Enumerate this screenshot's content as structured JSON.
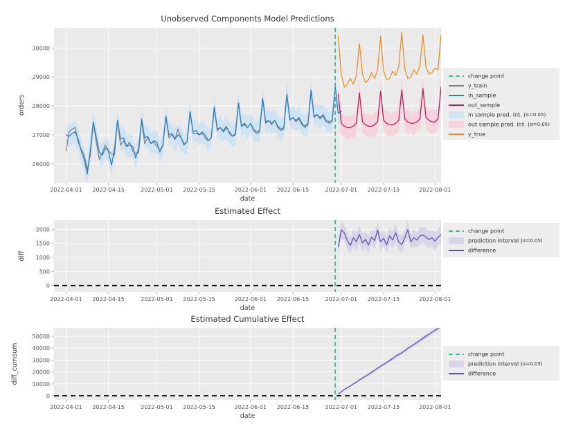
{
  "figure": {
    "background": "#ffffff",
    "panel_color": "#eaeaea",
    "xlabel": "date",
    "xticks": [
      "2022-04-01",
      "2022-04-15",
      "2022-05-01",
      "2022-05-15",
      "2022-06-01",
      "2022-06-15",
      "2022-07-01",
      "2022-07-15",
      "2022-08-01"
    ],
    "xlim": [
      "2022-03-28",
      "2022-08-03"
    ],
    "change_point": "2022-06-29"
  },
  "colors": {
    "change_point": "#3cb99a",
    "y_train": "#7f7f7f",
    "in_sample": "#2a7fc1",
    "out_sample": "#c2185b",
    "in_band": "#cfe3f2",
    "out_band": "#f6d3dd",
    "y_true": "#f08a1e",
    "difference": "#5c4fa8",
    "diff_band": "#d9d5e8",
    "zero_line": "#000000"
  },
  "chart_data": [
    {
      "type": "line",
      "title": "Unobserved Components Model Predictions",
      "xlabel": "date",
      "ylabel": "orders",
      "yticks": [
        26000,
        27000,
        28000,
        29000,
        30000
      ],
      "ylim": [
        25350,
        30700
      ],
      "grid": true,
      "legend_position": "right",
      "legend": [
        {
          "label": "change point",
          "style": "dashed-line",
          "color": "#3cb99a"
        },
        {
          "label": "y_train",
          "style": "line",
          "color": "#7f7f7f"
        },
        {
          "label": "in_sample",
          "style": "line",
          "color": "#2a7fc1"
        },
        {
          "label": "out_sample",
          "style": "line",
          "color": "#c2185b"
        },
        {
          "label": "in sample pred. int. (",
          "sub": "α=0.05)",
          "style": "band",
          "color": "#cfe3f2"
        },
        {
          "label": "out sample pred. int. (",
          "sub": "α=0.05)",
          "style": "band",
          "color": "#f6d3dd"
        },
        {
          "label": "y_true",
          "style": "line",
          "color": "#f08a1e"
        }
      ],
      "series": [
        {
          "name": "y_train",
          "color": "#7f7f7f",
          "x_start": "2022-04-01",
          "values": [
            26450,
            27100,
            27200,
            27250,
            26750,
            26500,
            26300,
            25800,
            26300,
            27450,
            26750,
            26150,
            26400,
            26650,
            26450,
            26350,
            26300,
            27500,
            26650,
            26800,
            26600,
            26750,
            26450,
            26350,
            26400,
            27500,
            26700,
            26900,
            26700,
            26750,
            26600,
            26500,
            26600,
            27650,
            26900,
            27000,
            26850,
            27200,
            26900,
            26700,
            26750,
            27800,
            27050,
            27050,
            27000,
            27050,
            26900,
            26800,
            26900,
            27950,
            27150,
            27250,
            27150,
            27300,
            27050,
            26950,
            27000,
            28100,
            27300,
            27350,
            27250,
            27400,
            27150,
            27050,
            27100,
            28250,
            27400,
            27500,
            27350,
            27500,
            27250,
            27150,
            27200,
            28400,
            27500,
            27600,
            27450,
            27550,
            27350,
            27250,
            27350,
            28500,
            27600,
            27700,
            27550,
            27650,
            27450,
            27400,
            27450,
            28650,
            27750,
            27800
          ]
        },
        {
          "name": "in_sample",
          "color": "#2a7fc1",
          "x_start": "2022-04-01",
          "values": [
            27000,
            26950,
            27050,
            27100,
            26850,
            26450,
            26150,
            25650,
            26450,
            27450,
            26900,
            26400,
            26300,
            26550,
            26450,
            25950,
            26500,
            27500,
            26850,
            26900,
            26600,
            26650,
            26600,
            26200,
            26550,
            27550,
            26900,
            26950,
            26700,
            26800,
            26750,
            26400,
            26650,
            27650,
            27000,
            27050,
            26850,
            27000,
            26900,
            26650,
            26750,
            27800,
            27100,
            27150,
            27000,
            27100,
            27000,
            26800,
            26900,
            27950,
            27200,
            27250,
            27100,
            27250,
            27100,
            26950,
            27050,
            28100,
            27300,
            27400,
            27250,
            27400,
            27200,
            27100,
            27150,
            28250,
            27450,
            27500,
            27400,
            27500,
            27300,
            27200,
            27250,
            28400,
            27550,
            27600,
            27500,
            27600,
            27400,
            27300,
            27400,
            28550,
            27650,
            27700,
            27600,
            27700,
            27500,
            27450,
            27500,
            28650,
            27750,
            27800
          ]
        },
        {
          "name": "out_sample",
          "color": "#c2185b",
          "x_start": "2022-06-30",
          "values": [
            28400,
            27400,
            27300,
            27250,
            27250,
            27300,
            27400,
            28450,
            27450,
            27350,
            27300,
            27300,
            27350,
            27450,
            28500,
            27500,
            27400,
            27350,
            27350,
            27400,
            27500,
            28550,
            27550,
            27450,
            27400,
            27400,
            27450,
            27550,
            28600,
            27600,
            27500,
            27450,
            27450,
            27550,
            28650
          ]
        },
        {
          "name": "y_true",
          "color": "#f08a1e",
          "x_start": "2022-06-30",
          "values": [
            30400,
            29100,
            28650,
            28750,
            28950,
            28750,
            29050,
            30150,
            29100,
            28800,
            28900,
            29150,
            28950,
            29250,
            30400,
            29200,
            28900,
            28950,
            29200,
            29050,
            29350,
            30550,
            29300,
            28950,
            29000,
            29250,
            29100,
            29400,
            30450,
            29350,
            29100,
            29150,
            29300,
            29250,
            30450
          ]
        }
      ],
      "bands": [
        {
          "name": "in sample pred. int.",
          "color": "#cfe3f2",
          "alpha": 0.05,
          "half_width": 420
        },
        {
          "name": "out sample pred. int.",
          "color": "#f6d3dd",
          "alpha": 0.05,
          "half_width": 430
        }
      ]
    },
    {
      "type": "line",
      "title": "Estimated Effect",
      "xlabel": "date",
      "ylabel": "diff",
      "yticks": [
        0,
        500,
        1000,
        1500,
        2000
      ],
      "ylim": [
        -230,
        2330
      ],
      "grid": true,
      "legend_position": "right",
      "legend": [
        {
          "label": "change point",
          "style": "dashed-line",
          "color": "#3cb99a"
        },
        {
          "label": "prediction interval (",
          "sub": "α=0.05)",
          "style": "band",
          "color": "#d9d5e8"
        },
        {
          "label": "difference",
          "style": "line",
          "color": "#5c4fa8"
        }
      ],
      "series": [
        {
          "name": "difference",
          "color": "#5c4fa8",
          "x_start": "2022-06-30",
          "values": [
            1380,
            1980,
            1870,
            1600,
            1430,
            1700,
            1560,
            1820,
            1520,
            1640,
            1440,
            1720,
            1600,
            1960,
            1560,
            1680,
            1450,
            1770,
            1620,
            1880,
            1550,
            1460,
            1700,
            1980,
            1560,
            1700,
            1620,
            1760,
            1800,
            1720,
            1640,
            1700,
            1580,
            1720,
            1800
          ]
        }
      ],
      "bands": [
        {
          "name": "prediction interval",
          "color": "#d9d5e8",
          "alpha": 0.05,
          "half_width": 330
        }
      ],
      "zero_line": true
    },
    {
      "type": "line",
      "title": "Estimated Cumulative Effect",
      "xlabel": "date",
      "ylabel": "diff_cumsum",
      "yticks": [
        0,
        10000,
        20000,
        30000,
        40000,
        50000
      ],
      "ylim": [
        -3500,
        57000
      ],
      "grid": true,
      "legend_position": "right",
      "legend": [
        {
          "label": "change point",
          "style": "dashed-line",
          "color": "#3cb99a"
        },
        {
          "label": "prediction interval (",
          "sub": "α=0.05)",
          "style": "band",
          "color": "#d9d5e8"
        },
        {
          "label": "difference",
          "style": "line",
          "color": "#5c4fa8"
        }
      ],
      "series": [
        {
          "name": "difference",
          "color": "#5c4fa8",
          "x_start": "2022-06-30",
          "values": [
            1380,
            3360,
            5230,
            6830,
            8260,
            9960,
            11520,
            13340,
            14860,
            16500,
            17940,
            19660,
            21260,
            23220,
            24780,
            26460,
            27910,
            29680,
            31300,
            33180,
            34730,
            36190,
            37890,
            39870,
            41430,
            43130,
            44750,
            46510,
            48310,
            50030,
            51670,
            53370,
            54950,
            56670,
            58470
          ]
        }
      ],
      "bands": [
        {
          "name": "prediction interval",
          "color": "#d9d5e8",
          "alpha": 0.05,
          "half_width_start": 330,
          "half_width_end": 2100
        }
      ],
      "zero_line": true
    }
  ]
}
